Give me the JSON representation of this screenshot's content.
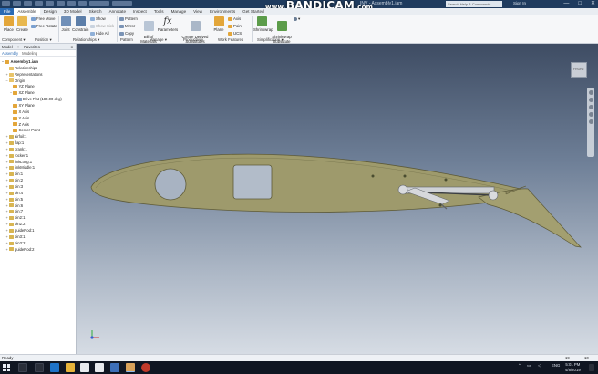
{
  "titlebar": {
    "app_title": "INV  -  Assembly1.iam",
    "search_placeholder": "Search Help & Commands...",
    "signin": "Sign In",
    "window_buttons": [
      "—",
      "□",
      "✕"
    ]
  },
  "watermark": {
    "prefix": "www.",
    "brand": "BANDICAM",
    "suffix": ".com"
  },
  "tabs": [
    "File",
    "Assemble",
    "Design",
    "3D Model",
    "Sketch",
    "Annotate",
    "Inspect",
    "Tools",
    "Manage",
    "View",
    "Environments",
    "Get Started"
  ],
  "ribbon": {
    "buttons": {
      "place": "Place",
      "create": "Create",
      "free_move": "Free Move",
      "free_rotate": "Free Rotate",
      "joint": "Joint",
      "constrain": "Constrain",
      "show": "Show",
      "show_sick": "Show Sick",
      "hide_all": "Hide All",
      "pattern": "Pattern",
      "mirror": "Mirror",
      "copy": "Copy",
      "bill_of_materials": "Bill of\nMaterials",
      "parameters": "Parameters",
      "create_derived": "Create Derived\nSubstitutes",
      "plane": "Plane",
      "axis": "Axis",
      "point": "Point",
      "ucs": "UCS",
      "shrinkwrap": "Shrinkwrap",
      "shrinkwrap_sub": "Shrinkwrap\nSubstitute"
    },
    "groups": [
      "Component ▾",
      "Position ▾",
      "Relationships ▾",
      "Pattern",
      "Manage ▾",
      "Productivity",
      "Work Features",
      "Simplification ▾"
    ]
  },
  "browser": {
    "tabs": [
      "Model",
      "+",
      "Favorites",
      "≡"
    ],
    "subtabs": [
      "Assembly",
      "Modeling"
    ],
    "nodes": [
      {
        "label": "Assembly1.iam",
        "level": 0,
        "kind": "asm",
        "expand": "−"
      },
      {
        "label": "Relationships",
        "level": 1,
        "kind": "folder",
        "expand": ""
      },
      {
        "label": "Representations",
        "level": 1,
        "kind": "folder",
        "expand": "+"
      },
      {
        "label": "Origin",
        "level": 1,
        "kind": "folder",
        "expand": "−"
      },
      {
        "label": "YZ Plane",
        "level": 2,
        "kind": "plane",
        "expand": ""
      },
      {
        "label": "XZ Plane",
        "level": 2,
        "kind": "plane",
        "expand": "−"
      },
      {
        "label": "Drive Flat (180.00 deg)",
        "level": 3,
        "kind": "constraint",
        "expand": ""
      },
      {
        "label": "XY Plane",
        "level": 2,
        "kind": "plane",
        "expand": ""
      },
      {
        "label": "X Axis",
        "level": 2,
        "kind": "axis",
        "expand": ""
      },
      {
        "label": "Y Axis",
        "level": 2,
        "kind": "axis",
        "expand": ""
      },
      {
        "label": "Z Axis",
        "level": 2,
        "kind": "axis",
        "expand": ""
      },
      {
        "label": "Center Point",
        "level": 2,
        "kind": "point",
        "expand": ""
      },
      {
        "label": "airfoil:1",
        "level": 1,
        "kind": "part",
        "expand": "+"
      },
      {
        "label": "flap:1",
        "level": 1,
        "kind": "part",
        "expand": "+"
      },
      {
        "label": "crank:1",
        "level": 1,
        "kind": "part",
        "expand": "+"
      },
      {
        "label": "rocker:1",
        "level": 1,
        "kind": "part",
        "expand": "+"
      },
      {
        "label": "linkLong:1",
        "level": 1,
        "kind": "part",
        "expand": "+"
      },
      {
        "label": "linkMiddle:1",
        "level": 1,
        "kind": "part",
        "expand": "+"
      },
      {
        "label": "pin:1",
        "level": 1,
        "kind": "part",
        "expand": "+"
      },
      {
        "label": "pin:2",
        "level": 1,
        "kind": "part",
        "expand": "+"
      },
      {
        "label": "pin:3",
        "level": 1,
        "kind": "part",
        "expand": "+"
      },
      {
        "label": "pin:4",
        "level": 1,
        "kind": "part",
        "expand": "+"
      },
      {
        "label": "pin:5",
        "level": 1,
        "kind": "part",
        "expand": "+"
      },
      {
        "label": "pin:6",
        "level": 1,
        "kind": "part",
        "expand": "+"
      },
      {
        "label": "pin:7",
        "level": 1,
        "kind": "part",
        "expand": "+"
      },
      {
        "label": "pin2:1",
        "level": 1,
        "kind": "part",
        "expand": "+"
      },
      {
        "label": "pin2:2",
        "level": 1,
        "kind": "part",
        "expand": "+"
      },
      {
        "label": "guideRod:1",
        "level": 1,
        "kind": "part",
        "expand": "+"
      },
      {
        "label": "pin3:1",
        "level": 1,
        "kind": "part",
        "expand": "+"
      },
      {
        "label": "pin3:2",
        "level": 1,
        "kind": "part",
        "expand": "+"
      },
      {
        "label": "guideRod:2",
        "level": 1,
        "kind": "part",
        "expand": "+"
      }
    ]
  },
  "viewcube_label": "FRONT",
  "statusbar": {
    "ready": "Ready",
    "count1": "19",
    "count2": "10"
  },
  "taskbar": {
    "language": "ENG",
    "time": "5:01 PM",
    "date": "4/8/2019"
  },
  "colors": {
    "part_fill": "#9e9a6c",
    "part_stroke": "#5d5a38",
    "accent": "#2a6ab4"
  }
}
